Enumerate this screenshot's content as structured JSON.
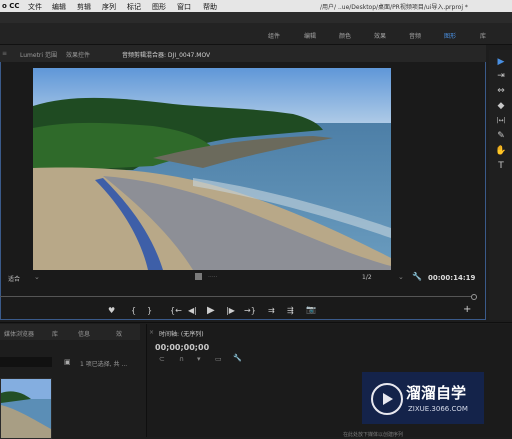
{
  "menubar": {
    "app": "o CC",
    "items": [
      "文件",
      "编辑",
      "剪辑",
      "序列",
      "标记",
      "图形",
      "窗口",
      "帮助"
    ],
    "path": "/用户/ ..ue/Desktop/桌面/PR视频项目/ui导入.prproj *"
  },
  "workspaces": [
    "组件",
    "编辑",
    "颜色",
    "效果",
    "音频",
    "图形",
    "库"
  ],
  "monitor": {
    "tabs": [
      "Lumetri 范围",
      "效果控件",
      "音频剪辑混合器: DJI_0047.MOV"
    ],
    "fit_label": "适合",
    "resolution": "1/2",
    "timecode": "00:00:14:19"
  },
  "transport": {
    "marker": "♥",
    "in": "{",
    "out": "}",
    "go_in": "{←",
    "step_back": "◀|",
    "play": "▶",
    "step_fwd": "|▶",
    "go_out": "→}",
    "insert": "⇉",
    "overwrite": "⇶",
    "export": "📷",
    "add": "+"
  },
  "tools": [
    "▶",
    "⇥",
    "⇔",
    "◆",
    "|↔|",
    "✎",
    "✋",
    "T"
  ],
  "project": {
    "tabs": [
      "媒体浏览器",
      "库",
      "信息",
      "效"
    ],
    "selection": "1 项已选择, 共 ..."
  },
  "sequence": {
    "tab": "时间轴: (无序列)",
    "timecode": "00;00;00;00",
    "empty_msg": "在此处放下媒体以创建序列"
  },
  "watermark": {
    "title": "溜溜自学",
    "url": "ZIXUE.3066.COM"
  }
}
